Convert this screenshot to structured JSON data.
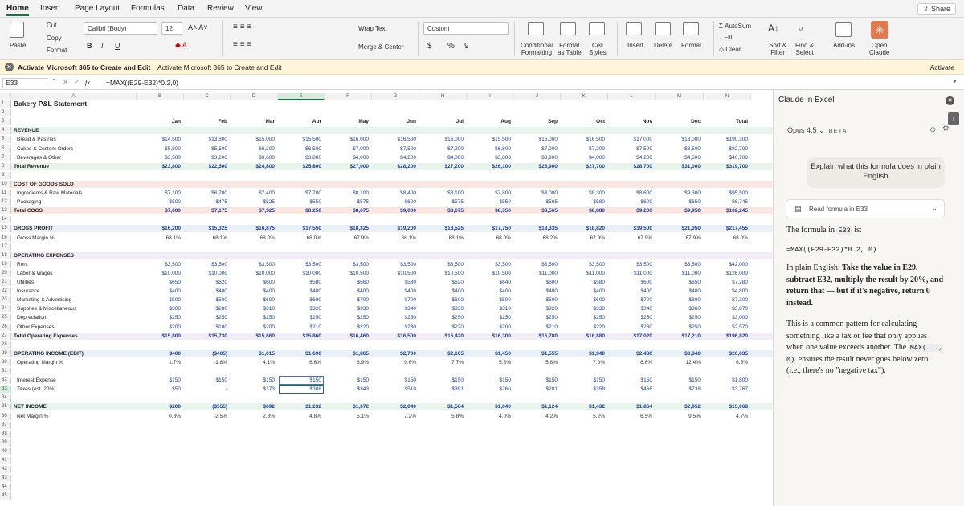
{
  "menubar": {
    "tabs": [
      "Home",
      "Insert",
      "Page Layout",
      "Formulas",
      "Data",
      "Review",
      "View"
    ],
    "share": "Share"
  },
  "ribbon": {
    "paste": "Paste",
    "cut": "Cut",
    "copy": "Copy",
    "format": "Format",
    "font": "Calibri (Body)",
    "size": "12",
    "bold": "B",
    "italic": "I",
    "underline": "U",
    "wrap": "Wrap Text",
    "merge": "Merge & Center",
    "numfmt": "Custom",
    "currency": "$",
    "percent": "%",
    "comma": "9",
    "cond": "Conditional\nFormatting",
    "fmttable": "Format\nas Table",
    "cellstyles": "Cell\nStyles",
    "insert": "Insert",
    "delete": "Delete",
    "format2": "Format",
    "autosum": "AutoSum",
    "fill": "Fill",
    "clear": "Clear",
    "sort": "Sort &\nFilter",
    "find": "Find &\nSelect",
    "addins": "Add-ins",
    "openclaude": "Open\nClaude"
  },
  "banner": {
    "title": "Activate Microsoft 365 to Create and Edit",
    "desc": "Activate Microsoft 365 to Create and Edit",
    "button": "Activate"
  },
  "formula_bar": {
    "cell": "E33",
    "fx": "fx",
    "formula": "=MAX((E29-E32)*0.2,0)"
  },
  "columns": [
    "A",
    "B",
    "C",
    "D",
    "E",
    "F",
    "G",
    "H",
    "I",
    "J",
    "K",
    "L",
    "M",
    "N"
  ],
  "rows": [
    {
      "n": 1,
      "label": "Bakery P&L Statement",
      "title": true,
      "v": []
    },
    {
      "n": 2,
      "label": "",
      "v": []
    },
    {
      "n": 3,
      "label": "",
      "hdr": true,
      "v": [
        "Jan",
        "Feb",
        "Mar",
        "Apr",
        "May",
        "Jun",
        "Jul",
        "Aug",
        "Sep",
        "Oct",
        "Nov",
        "Dec",
        "Total"
      ]
    },
    {
      "n": 4,
      "label": "REVENUE",
      "bold": true,
      "bg": "#e8f4ec",
      "v": []
    },
    {
      "n": 5,
      "label": "Bread & Pastries",
      "indent": true,
      "v": [
        "$14,500",
        "$13,800",
        "$15,000",
        "$15,500",
        "$16,000",
        "$16,500",
        "$16,000",
        "$15,500",
        "$16,000",
        "$16,500",
        "$17,000",
        "$18,000",
        "$190,300"
      ]
    },
    {
      "n": 6,
      "label": "Cakes & Custom Orders",
      "indent": true,
      "v": [
        "$5,800",
        "$5,500",
        "$6,200",
        "$6,500",
        "$7,000",
        "$7,500",
        "$7,200",
        "$6,800",
        "$7,000",
        "$7,200",
        "$7,500",
        "$8,500",
        "$82,700"
      ]
    },
    {
      "n": 7,
      "label": "Beverages & Other",
      "indent": true,
      "v": [
        "$3,500",
        "$3,200",
        "$3,600",
        "$3,800",
        "$4,000",
        "$4,200",
        "$4,000",
        "$3,800",
        "$3,900",
        "$4,000",
        "$4,200",
        "$4,500",
        "$46,700"
      ]
    },
    {
      "n": 8,
      "label": "Total Revenue",
      "bold": true,
      "bg": "#e8f4ec",
      "v": [
        "$23,800",
        "$22,500",
        "$24,800",
        "$25,800",
        "$27,000",
        "$28,200",
        "$27,200",
        "$26,100",
        "$26,900",
        "$27,700",
        "$28,700",
        "$31,000",
        "$319,700"
      ]
    },
    {
      "n": 9,
      "label": "",
      "v": []
    },
    {
      "n": 10,
      "label": "COST OF GOODS SOLD",
      "bold": true,
      "bg": "#fbe7e1",
      "v": []
    },
    {
      "n": 11,
      "label": "Ingredients & Raw Materials",
      "indent": true,
      "v": [
        "$7,100",
        "$6,700",
        "$7,400",
        "$7,700",
        "$8,100",
        "$8,400",
        "$8,100",
        "$7,800",
        "$8,000",
        "$8,300",
        "$8,600",
        "$9,300",
        "$95,500"
      ]
    },
    {
      "n": 12,
      "label": "Packaging",
      "indent": true,
      "v": [
        "$500",
        "$475",
        "$525",
        "$550",
        "$575",
        "$600",
        "$575",
        "$550",
        "$565",
        "$580",
        "$600",
        "$650",
        "$6,745"
      ]
    },
    {
      "n": 13,
      "label": "Total COGS",
      "bold": true,
      "bg": "#fbe7e1",
      "v": [
        "$7,600",
        "$7,175",
        "$7,925",
        "$8,250",
        "$8,675",
        "$9,000",
        "$8,675",
        "$8,350",
        "$8,565",
        "$8,880",
        "$9,200",
        "$9,950",
        "$102,245"
      ]
    },
    {
      "n": 14,
      "label": "",
      "v": []
    },
    {
      "n": 15,
      "label": "GROSS PROFIT",
      "bold": true,
      "bg": "#e9f0f8",
      "v": [
        "$16,200",
        "$15,325",
        "$16,875",
        "$17,550",
        "$18,325",
        "$19,200",
        "$18,525",
        "$17,750",
        "$18,335",
        "$18,820",
        "$19,500",
        "$21,050",
        "$217,455"
      ]
    },
    {
      "n": 16,
      "label": "Gross Margin %",
      "indent": true,
      "pct": true,
      "v": [
        "68.1%",
        "68.1%",
        "68.0%",
        "68.0%",
        "67.9%",
        "68.1%",
        "68.1%",
        "68.0%",
        "68.2%",
        "67.9%",
        "67.9%",
        "67.9%",
        "68.0%"
      ]
    },
    {
      "n": 17,
      "label": "",
      "v": []
    },
    {
      "n": 18,
      "label": "OPERATING EXPENSES",
      "bold": true,
      "bg": "#f1ecf6",
      "v": []
    },
    {
      "n": 19,
      "label": "Rent",
      "indent": true,
      "v": [
        "$3,500",
        "$3,500",
        "$3,500",
        "$3,500",
        "$3,500",
        "$3,500",
        "$3,500",
        "$3,500",
        "$3,500",
        "$3,500",
        "$3,500",
        "$3,500",
        "$42,000"
      ]
    },
    {
      "n": 20,
      "label": "Labor & Wages",
      "indent": true,
      "v": [
        "$10,000",
        "$10,000",
        "$10,000",
        "$10,000",
        "$10,500",
        "$10,500",
        "$10,500",
        "$10,500",
        "$11,000",
        "$11,000",
        "$11,000",
        "$11,000",
        "$126,000"
      ]
    },
    {
      "n": 21,
      "label": "Utilities",
      "indent": true,
      "v": [
        "$650",
        "$620",
        "$600",
        "$580",
        "$560",
        "$580",
        "$620",
        "$640",
        "$600",
        "$580",
        "$600",
        "$650",
        "$7,280"
      ]
    },
    {
      "n": 22,
      "label": "Insurance",
      "indent": true,
      "v": [
        "$400",
        "$400",
        "$400",
        "$400",
        "$400",
        "$400",
        "$400",
        "$400",
        "$400",
        "$400",
        "$400",
        "$400",
        "$4,800"
      ]
    },
    {
      "n": 23,
      "label": "Marketing & Advertising",
      "indent": true,
      "v": [
        "$500",
        "$500",
        "$600",
        "$600",
        "$700",
        "$700",
        "$600",
        "$500",
        "$500",
        "$600",
        "$700",
        "$800",
        "$7,300"
      ]
    },
    {
      "n": 24,
      "label": "Supplies & Miscellaneous",
      "indent": true,
      "v": [
        "$300",
        "$280",
        "$310",
        "$320",
        "$330",
        "$340",
        "$330",
        "$310",
        "$320",
        "$330",
        "$340",
        "$360",
        "$3,870"
      ]
    },
    {
      "n": 25,
      "label": "Depreciation",
      "indent": true,
      "v": [
        "$250",
        "$250",
        "$250",
        "$250",
        "$250",
        "$250",
        "$250",
        "$250",
        "$250",
        "$250",
        "$250",
        "$250",
        "$3,000"
      ]
    },
    {
      "n": 26,
      "label": "Other Expenses",
      "indent": true,
      "v": [
        "$200",
        "$180",
        "$200",
        "$210",
        "$220",
        "$230",
        "$220",
        "$200",
        "$210",
        "$220",
        "$230",
        "$250",
        "$2,570"
      ]
    },
    {
      "n": 27,
      "label": "Total Operating Expenses",
      "bold": true,
      "bg": "#f1ecf6",
      "v": [
        "$15,800",
        "$15,730",
        "$15,860",
        "$15,860",
        "$16,460",
        "$16,500",
        "$16,420",
        "$16,300",
        "$16,780",
        "$16,880",
        "$17,020",
        "$17,210",
        "$196,820"
      ]
    },
    {
      "n": 28,
      "label": "",
      "v": []
    },
    {
      "n": 29,
      "label": "OPERATING INCOME (EBIT)",
      "bold": true,
      "bg": "#e9f0f8",
      "v": [
        "$400",
        "($405)",
        "$1,015",
        "$1,690",
        "$1,865",
        "$2,700",
        "$2,105",
        "$1,450",
        "$1,555",
        "$1,940",
        "$2,480",
        "$3,840",
        "$20,635"
      ]
    },
    {
      "n": 30,
      "label": "Operating Margin %",
      "indent": true,
      "pct": true,
      "v": [
        "1.7%",
        "-1.8%",
        "4.1%",
        "6.6%",
        "6.9%",
        "9.6%",
        "7.7%",
        "5.6%",
        "5.8%",
        "7.0%",
        "8.6%",
        "12.4%",
        "6.5%"
      ]
    },
    {
      "n": 31,
      "label": "",
      "v": []
    },
    {
      "n": 32,
      "label": "Interest Expense",
      "indent": true,
      "v": [
        "$150",
        "$150",
        "$150",
        "$150",
        "$150",
        "$150",
        "$150",
        "$150",
        "$150",
        "$150",
        "$150",
        "$150",
        "$1,800"
      ]
    },
    {
      "n": 33,
      "label": "Taxes (est. 20%)",
      "indent": true,
      "v": [
        "$50",
        "-",
        "$173",
        "$308",
        "$343",
        "$510",
        "$391",
        "$260",
        "$281",
        "$358",
        "$466",
        "$738",
        "$3,767"
      ]
    },
    {
      "n": 34,
      "label": "",
      "v": []
    },
    {
      "n": 35,
      "label": "NET INCOME",
      "bold": true,
      "bg": "#e8f4ec",
      "v": [
        "$200",
        "($555)",
        "$692",
        "$1,232",
        "$1,372",
        "$2,040",
        "$1,564",
        "$1,040",
        "$1,124",
        "$1,432",
        "$1,864",
        "$2,952",
        "$15,068"
      ]
    },
    {
      "n": 36,
      "label": "Net Margin %",
      "indent": true,
      "pct": true,
      "v": [
        "0.8%",
        "-2.5%",
        "2.8%",
        "4.8%",
        "5.1%",
        "7.2%",
        "5.8%",
        "4.0%",
        "4.2%",
        "5.2%",
        "6.5%",
        "9.5%",
        "4.7%"
      ]
    },
    {
      "n": 37,
      "label": "",
      "v": []
    },
    {
      "n": 38,
      "label": "",
      "v": []
    },
    {
      "n": 39,
      "label": "",
      "v": []
    },
    {
      "n": 40,
      "label": "",
      "v": []
    },
    {
      "n": 41,
      "label": "",
      "v": []
    },
    {
      "n": 42,
      "label": "",
      "v": []
    },
    {
      "n": 43,
      "label": "",
      "v": []
    },
    {
      "n": 44,
      "label": "",
      "v": []
    },
    {
      "n": 45,
      "label": "",
      "v": []
    }
  ],
  "panel": {
    "title": "Claude in Excel",
    "model": "Opus 4.5",
    "beta": "BETA",
    "user_msg": "Explain what this formula does in plain English",
    "tool": "Read formula in E33",
    "p1_pre": "The formula in",
    "p1_ref": "E33",
    "p1_post": "is:",
    "code": "=MAX((E29-E32)*0.2, 0)",
    "p2_pre": "In plain English:",
    "p2_bold": "Take the value in E29, subtract E32, multiply the result by 20%, and return that — but if it's negative, return 0 instead.",
    "p3_a": "This is a common pattern for calculating something like a tax or fee that only applies when one value exceeds another. The",
    "p3_code": "MAX(..., 0)",
    "p3_b": "ensures the result never goes below zero (i.e., there's no \"negative tax\")."
  },
  "colors": {
    "accent": "#1e7145",
    "number": "#1f3f8f",
    "banner": "#fff6d9"
  }
}
